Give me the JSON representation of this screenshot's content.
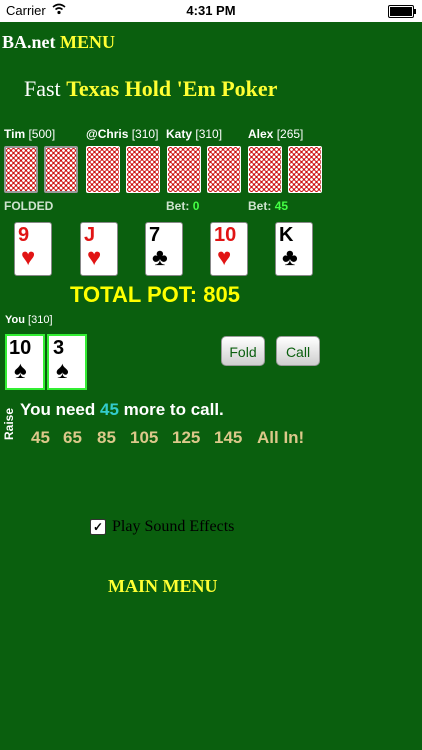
{
  "status_bar": {
    "carrier": "Carrier",
    "time": "4:31 PM"
  },
  "nav": {
    "site": "BA.net",
    "menu": "MENU"
  },
  "title": {
    "prefix": "Fast",
    "name": "Texas Hold 'Em Poker"
  },
  "players": [
    {
      "name": "Tim",
      "chips": "[500]",
      "status": "FOLDED"
    },
    {
      "name": "@Chris",
      "chips": "[310]",
      "status": ""
    },
    {
      "name": "Katy",
      "chips": "[310]",
      "status_label": "Bet:",
      "bet": "0"
    },
    {
      "name": "Alex",
      "chips": "[265]",
      "status_label": "Bet:",
      "bet": "45"
    }
  ],
  "community_cards": [
    {
      "rank": "9",
      "suit": "♥",
      "color": "red"
    },
    {
      "rank": "J",
      "suit": "♥",
      "color": "red"
    },
    {
      "rank": "7",
      "suit": "♣",
      "color": "black"
    },
    {
      "rank": "10",
      "suit": "♥",
      "color": "red"
    },
    {
      "rank": "K",
      "suit": "♣",
      "color": "black"
    }
  ],
  "pot": {
    "label": "TOTAL POT: 805"
  },
  "you": {
    "name": "You",
    "chips": "[310]"
  },
  "your_cards": [
    {
      "rank": "10",
      "suit": "♠",
      "color": "black"
    },
    {
      "rank": "3",
      "suit": "♠",
      "color": "black"
    }
  ],
  "actions": {
    "fold": "Fold",
    "call": "Call"
  },
  "raise": {
    "label": "Raise",
    "need_prefix": "You need",
    "need_amount": "45",
    "need_suffix": "more to call.",
    "options": [
      "45",
      "65",
      "85",
      "105",
      "125",
      "145",
      "All In!"
    ]
  },
  "settings": {
    "sound_label": "Play Sound Effects",
    "sound_checked": true
  },
  "footer": {
    "main_menu": "MAIN MENU"
  },
  "colors": {
    "felt": "#0a5f0e",
    "highlight": "#ffff33",
    "pot": "#ffff00",
    "raise_options": "#dcc88a"
  }
}
